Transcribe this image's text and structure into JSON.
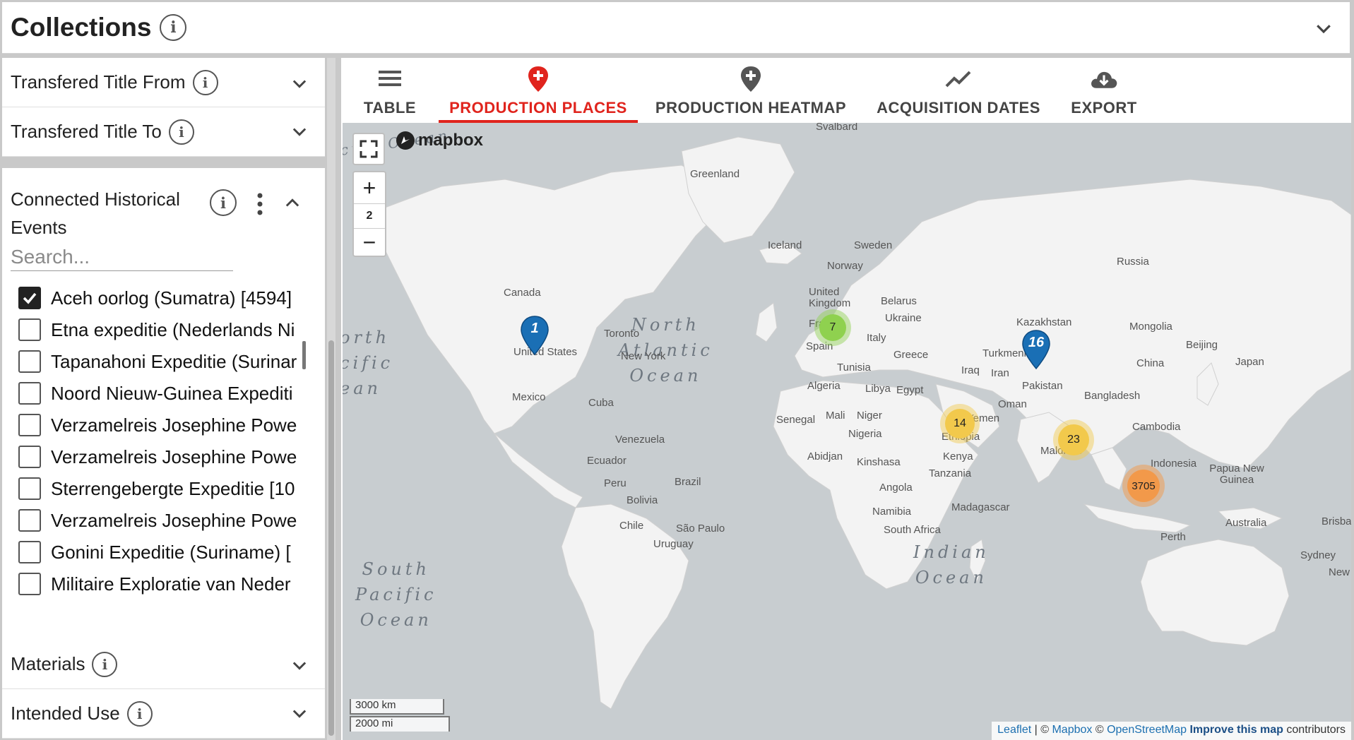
{
  "header": {
    "title": "Collections",
    "info_glyph": "i"
  },
  "left_panel": {
    "filters_top": [
      {
        "label": "Transfered Title From"
      },
      {
        "label": "Transfered Title To"
      }
    ],
    "events": {
      "title": "Connected Historical Events",
      "search_placeholder": "Search...",
      "items": [
        {
          "label": "Aceh oorlog (Sumatra) [4594]",
          "checked": true
        },
        {
          "label": "Etna expeditie (Nederlands Ni",
          "checked": false
        },
        {
          "label": "Tapanahoni Expeditie (Surinar",
          "checked": false
        },
        {
          "label": "Noord Nieuw-Guinea Expediti",
          "checked": false
        },
        {
          "label": "Verzamelreis Josephine Powe",
          "checked": false
        },
        {
          "label": "Verzamelreis Josephine Powe",
          "checked": false
        },
        {
          "label": "Sterrengebergte Expeditie [10",
          "checked": false
        },
        {
          "label": "Verzamelreis Josephine Powe",
          "checked": false
        },
        {
          "label": "Gonini Expeditie (Suriname) [",
          "checked": false
        },
        {
          "label": "Militaire Exploratie van Neder",
          "checked": false
        }
      ]
    },
    "filters_bottom": [
      {
        "label": "Materials"
      },
      {
        "label": "Intended Use"
      }
    ]
  },
  "tabs": [
    {
      "label": "TABLE",
      "icon": "list-icon",
      "active": false
    },
    {
      "label": "PRODUCTION PLACES",
      "icon": "map-pin-plus-icon",
      "active": true
    },
    {
      "label": "PRODUCTION HEATMAP",
      "icon": "map-pin-plus-icon",
      "active": false
    },
    {
      "label": "ACQUISITION DATES",
      "icon": "line-chart-icon",
      "active": false
    },
    {
      "label": "EXPORT",
      "icon": "cloud-download-icon",
      "active": false
    }
  ],
  "colors": {
    "accent": "#e0241d",
    "pin": "#1a6fb5",
    "cluster_green": "#8fd14f",
    "cluster_yellow": "#f2c94c",
    "cluster_orange": "#f2994a"
  },
  "map": {
    "logo": "mapbox",
    "zoom_level": "2",
    "zoom_in": "+",
    "zoom_out": "−",
    "scale_km": "3000 km",
    "scale_mi": "2000 mi",
    "clusters": [
      {
        "count": "7",
        "color": "green"
      },
      {
        "count": "14",
        "color": "yellow"
      },
      {
        "count": "23",
        "color": "yellow"
      },
      {
        "count": "3705",
        "color": "orange"
      }
    ],
    "pins": [
      {
        "count": "1"
      },
      {
        "count": "16"
      }
    ],
    "places": {
      "svalbard": "Svalbard",
      "greenland": "Greenland",
      "iceland": "Iceland",
      "sweden": "Sweden",
      "norway": "Norway",
      "russia": "Russia",
      "canada": "Canada",
      "uk": "United Kingdom",
      "belarus": "Belarus",
      "ukraine": "Ukraine",
      "france": "France",
      "kazakhstan": "Kazakhstan",
      "mongolia": "Mongolia",
      "toronto": "Toronto",
      "us": "United States",
      "newyork": "New York",
      "spain": "Spain",
      "italy": "Italy",
      "greece": "Greece",
      "turkmenistan": "Turkmenistan",
      "beijing": "Beijing",
      "japan": "Japan",
      "china": "China",
      "tunisia": "Tunisia",
      "iraq": "Iraq",
      "iran": "Iran",
      "algeria": "Algeria",
      "libya": "Libya",
      "egypt": "Egypt",
      "pakistan": "Pakistan",
      "mexico": "Mexico",
      "cuba": "Cuba",
      "oman": "Oman",
      "bangladesh": "Bangladesh",
      "yemen": "Yemen",
      "senegal": "Senegal",
      "mali": "Mali",
      "niger": "Niger",
      "nigeria": "Nigeria",
      "ethiopia": "Ethiopia",
      "cambodia": "Cambodia",
      "venezuela": "Venezuela",
      "abidjan": "Abidjan",
      "kenya": "Kenya",
      "maldives": "Maldives",
      "indonesia": "Indonesia",
      "ecuador": "Ecuador",
      "kinshasa": "Kinshasa",
      "tanzania": "Tanzania",
      "png": "Papua New Guinea",
      "peru": "Peru",
      "brazil": "Brazil",
      "angola": "Angola",
      "bolivia": "Bolivia",
      "namibia": "Namibia",
      "madagascar": "Madagascar",
      "australia": "Australia",
      "brisbane": "Brisbane",
      "chile": "Chile",
      "saopaulo": "São Paulo",
      "southafrica": "South Africa",
      "uruguay": "Uruguay",
      "perth": "Perth",
      "sydney": "Sydney",
      "new": "New"
    },
    "oceans": {
      "north_atlantic": "North\nAtlantic\nOcean",
      "north_pacific": "orth\ncific\nean",
      "south_pacific": "South\nPacific\nOcean",
      "indian": "Indian\nOcean",
      "arctic": "ctic Ocean"
    },
    "attribution": {
      "leaflet": "Leaflet",
      "sep": " | © ",
      "mapbox": "Mapbox",
      "sep2": " © ",
      "osm": "OpenStreetMap",
      "improve": " Improve this map",
      "contrib": " contributors"
    }
  }
}
